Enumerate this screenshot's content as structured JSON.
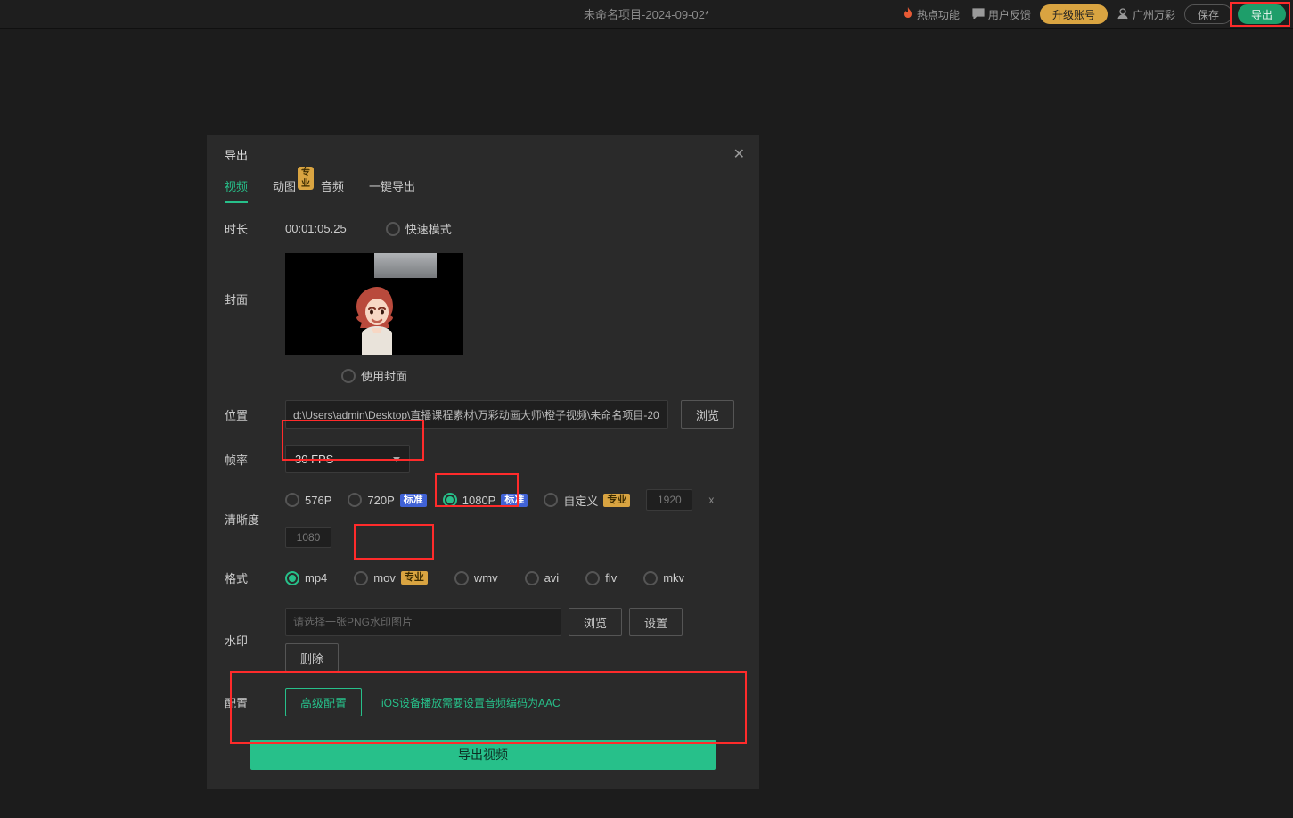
{
  "topbar": {
    "title": "未命名项目-2024-09-02*",
    "hot": "热点功能",
    "feedback": "用户反馈",
    "upgrade": "升级账号",
    "account": "广州万彩",
    "save": "保存",
    "export": "导出"
  },
  "modal": {
    "title": "导出",
    "tabs": {
      "video": "视频",
      "gif": "动图",
      "audio": "音频",
      "onekey": "一键导出",
      "pro_badge": "专业"
    },
    "duration": {
      "label": "时长",
      "value": "00:01:05.25",
      "fast": "快速模式"
    },
    "cover": {
      "label": "封面",
      "use_cover": "使用封面"
    },
    "path": {
      "label": "位置",
      "value": "d:\\Users\\admin\\Desktop\\直播课程素材\\万彩动画大师\\橙子视频\\未命名项目-20",
      "browse": "浏览"
    },
    "fps": {
      "label": "帧率",
      "value": "30 FPS"
    },
    "res": {
      "label": "清晰度",
      "r576": "576P",
      "r720": "720P",
      "r1080": "1080P",
      "std": "标准",
      "custom": "自定义",
      "pro": "专业",
      "w": "1920",
      "x": "x",
      "h": "1080"
    },
    "format": {
      "label": "格式",
      "mp4": "mp4",
      "mov": "mov",
      "wmv": "wmv",
      "avi": "avi",
      "flv": "flv",
      "mkv": "mkv",
      "pro": "专业"
    },
    "watermark": {
      "label": "水印",
      "placeholder": "请选择一张PNG水印图片",
      "browse": "浏览",
      "settings": "设置",
      "delete": "删除"
    },
    "config": {
      "label": "配置",
      "advanced": "高级配置",
      "tip": "iOS设备播放需要设置音频编码为AAC"
    },
    "export_btn": "导出视频"
  }
}
